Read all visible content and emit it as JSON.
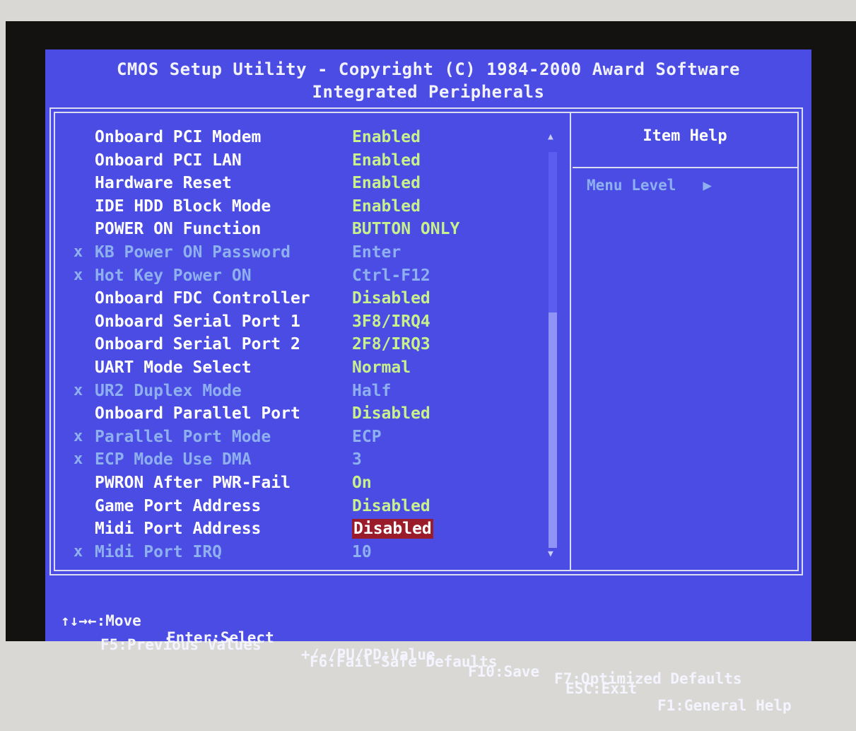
{
  "header": {
    "title": "CMOS Setup Utility - Copyright (C) 1984-2000 Award Software",
    "subtitle": "Integrated Peripherals"
  },
  "settings": [
    {
      "mark": "",
      "label": "Onboard PCI Modem",
      "value": "Enabled",
      "state": "active"
    },
    {
      "mark": "",
      "label": "Onboard PCI LAN",
      "value": "Enabled",
      "state": "active"
    },
    {
      "mark": "",
      "label": "Hardware Reset",
      "value": "Enabled",
      "state": "active"
    },
    {
      "mark": "",
      "label": "IDE HDD Block Mode",
      "value": "Enabled",
      "state": "active"
    },
    {
      "mark": "",
      "label": "POWER ON Function",
      "value": "BUTTON ONLY",
      "state": "active"
    },
    {
      "mark": "x",
      "label": "KB Power ON Password",
      "value": "Enter",
      "state": "dim"
    },
    {
      "mark": "x",
      "label": "Hot Key Power ON",
      "value": "Ctrl-F12",
      "state": "dim"
    },
    {
      "mark": "",
      "label": "Onboard FDC Controller",
      "value": "Disabled",
      "state": "active"
    },
    {
      "mark": "",
      "label": "Onboard Serial Port 1",
      "value": "3F8/IRQ4",
      "state": "active"
    },
    {
      "mark": "",
      "label": "Onboard Serial Port 2",
      "value": "2F8/IRQ3",
      "state": "active"
    },
    {
      "mark": "",
      "label": "UART Mode Select",
      "value": "Normal",
      "state": "active"
    },
    {
      "mark": "x",
      "label": "UR2 Duplex Mode",
      "value": "Half",
      "state": "dim"
    },
    {
      "mark": "",
      "label": "Onboard Parallel Port",
      "value": "Disabled",
      "state": "active"
    },
    {
      "mark": "x",
      "label": "Parallel Port Mode",
      "value": "ECP",
      "state": "dim"
    },
    {
      "mark": "x",
      "label": "ECP Mode Use DMA",
      "value": "3",
      "state": "dim"
    },
    {
      "mark": "",
      "label": "PWRON After PWR-Fail",
      "value": "On",
      "state": "active"
    },
    {
      "mark": "",
      "label": "Game Port Address",
      "value": "Disabled",
      "state": "active"
    },
    {
      "mark": "",
      "label": "Midi Port Address",
      "value": "Disabled",
      "state": "selected"
    },
    {
      "mark": "x",
      "label": "Midi Port IRQ",
      "value": "10",
      "state": "dim"
    }
  ],
  "help": {
    "title": "Item Help",
    "menu_level": "Menu Level   ▶"
  },
  "footer": {
    "line1": [
      "↑↓→←:Move",
      "Enter:Select",
      "+/-/PU/PD:Value",
      "F10:Save",
      "ESC:Exit",
      "F1:General Help"
    ],
    "line2": [
      "F5:Previous Values",
      "F6:Fail-Safe Defaults",
      "F7:Optimized Defaults"
    ]
  },
  "colors": {
    "screen_bg": "#4a4ce4",
    "value_text": "#c8f08c",
    "disabled_text": "#8fb0ee",
    "highlight_bg": "#9a1c2a"
  },
  "scrollbar": {
    "up_icon": "▲",
    "down_icon": "▼"
  }
}
